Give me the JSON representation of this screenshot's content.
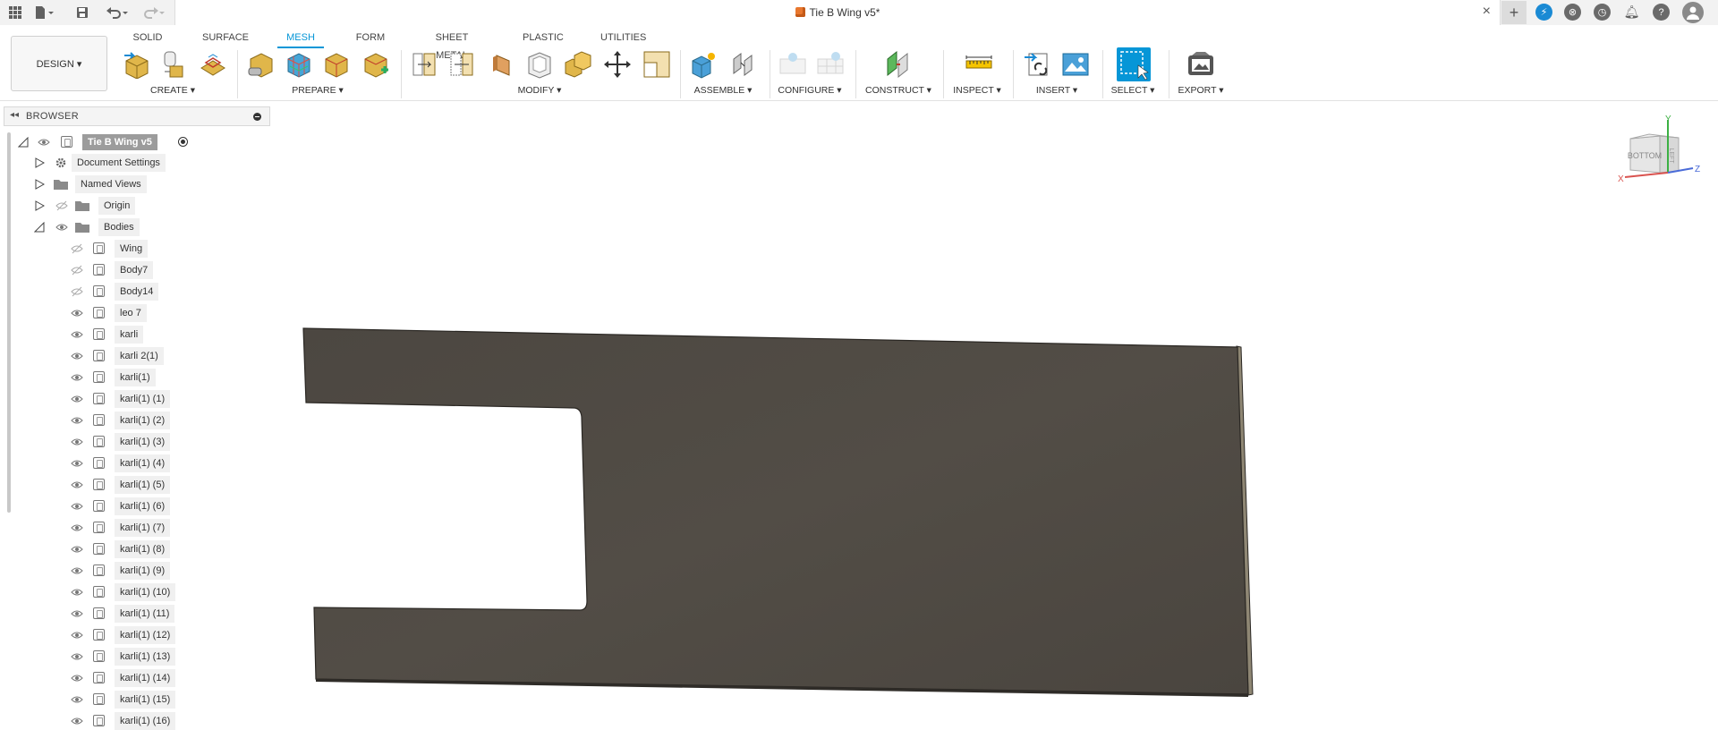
{
  "window": {
    "document_title": "Tie B Wing v5*",
    "close_tab_symbol": "×",
    "new_tab_symbol": "+"
  },
  "toolbar": {
    "workspace_button": "DESIGN ▾",
    "tabs": [
      "SOLID",
      "SURFACE",
      "MESH",
      "FORM",
      "SHEET METAL",
      "PLASTIC",
      "UTILITIES"
    ],
    "active_tab": "MESH",
    "groups": [
      "CREATE ▾",
      "PREPARE ▾",
      "MODIFY ▾",
      "ASSEMBLE ▾",
      "CONFIGURE ▾",
      "CONSTRUCT ▾",
      "INSPECT ▾",
      "INSERT ▾",
      "SELECT ▾",
      "EXPORT ▾"
    ]
  },
  "browser": {
    "title": "BROWSER",
    "collapse_symbol": "◂◂",
    "root": "Tie B Wing v5",
    "folders": [
      "Document Settings",
      "Named Views",
      "Origin",
      "Bodies"
    ],
    "bodies": [
      {
        "name": "Wing",
        "visible": false
      },
      {
        "name": "Body7",
        "visible": false
      },
      {
        "name": "Body14",
        "visible": false
      },
      {
        "name": "leo 7",
        "visible": true
      },
      {
        "name": "karli",
        "visible": true
      },
      {
        "name": "karli 2(1)",
        "visible": true
      },
      {
        "name": "karli(1)",
        "visible": true
      },
      {
        "name": "karli(1) (1)",
        "visible": true
      },
      {
        "name": "karli(1) (2)",
        "visible": true
      },
      {
        "name": "karli(1) (3)",
        "visible": true
      },
      {
        "name": "karli(1) (4)",
        "visible": true
      },
      {
        "name": "karli(1) (5)",
        "visible": true
      },
      {
        "name": "karli(1) (6)",
        "visible": true
      },
      {
        "name": "karli(1) (7)",
        "visible": true
      },
      {
        "name": "karli(1) (8)",
        "visible": true
      },
      {
        "name": "karli(1) (9)",
        "visible": true
      },
      {
        "name": "karli(1) (10)",
        "visible": true
      },
      {
        "name": "karli(1) (11)",
        "visible": true
      },
      {
        "name": "karli(1) (12)",
        "visible": true
      },
      {
        "name": "karli(1) (13)",
        "visible": true
      },
      {
        "name": "karli(1) (14)",
        "visible": true
      },
      {
        "name": "karli(1) (15)",
        "visible": true
      },
      {
        "name": "karli(1) (16)",
        "visible": true
      }
    ]
  },
  "viewcube": {
    "face_front": "BOTTOM",
    "face_side": "LEFT",
    "axis_x": "X",
    "axis_y": "Y",
    "axis_z": "Z"
  },
  "colors": {
    "accent": "#0696d7",
    "model_face": "#4f4a43",
    "model_edge": "#2a2723"
  }
}
